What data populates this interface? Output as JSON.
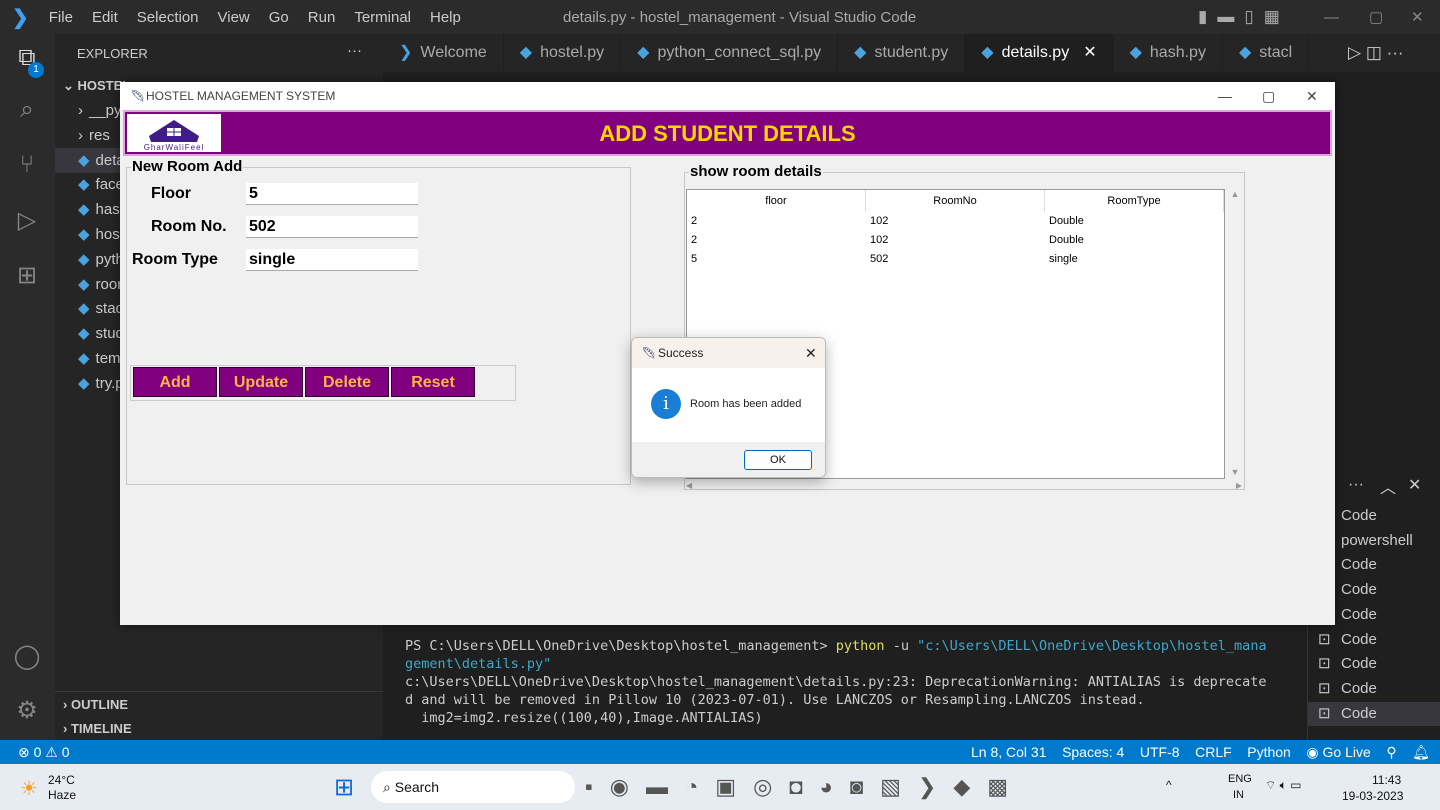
{
  "vscode": {
    "menu": [
      "File",
      "Edit",
      "Selection",
      "View",
      "Go",
      "Run",
      "Terminal",
      "Help"
    ],
    "window_title": "details.py - hostel_management - Visual Studio Code",
    "explorer_title": "EXPLORER",
    "explorer_badge": "1",
    "folder": "HOSTEL",
    "files": [
      "__py",
      "res",
      "deta",
      "face",
      "hash",
      "host",
      "pyth",
      "roor",
      "stacl",
      "stud",
      "temp",
      "try.p"
    ],
    "outline": "OUTLINE",
    "timeline": "TIMELINE",
    "tabs": [
      "Welcome",
      "hostel.py",
      "python_connect_sql.py",
      "student.py",
      "details.py",
      "hash.py",
      "stacl"
    ],
    "active_tab": "details.py",
    "terminal_lines": [
      "PS C:\\Users\\DELL\\OneDrive\\Desktop\\hostel_management> ",
      "python",
      " -u ",
      "\"c:\\Users\\DELL\\OneDrive\\Desktop\\hostel_mana",
      "gement\\details.py\"",
      "c:\\Users\\DELL\\OneDrive\\Desktop\\hostel_management\\details.py:23: DeprecationWarning: ANTIALIAS is deprecate",
      "d and will be removed in Pillow 10 (2023-07-01). Use LANCZOS or Resampling.LANCZOS instead.",
      "  img2=img2.resize((100,40),Image.ANTIALIAS)"
    ],
    "terminal_list": [
      "Code",
      "powershell",
      "Code",
      "Code",
      "Code",
      "Code",
      "Code",
      "Code",
      "Code"
    ],
    "status": {
      "errors": "0",
      "warnings": "0",
      "position": "Ln 8, Col 31",
      "spaces": "Spaces: 4",
      "encoding": "UTF-8",
      "eol": "CRLF",
      "language": "Python",
      "golive": "Go Live"
    }
  },
  "taskbar": {
    "temp": "24°C",
    "weather": "Haze",
    "search": "Search",
    "lang1": "ENG",
    "lang2": "IN",
    "time": "11:43",
    "date": "19-03-2023"
  },
  "app": {
    "title": "HOSTEL MANAGEMENT SYSTEM",
    "header": "ADD STUDENT DETAILS",
    "logo_text": "GharWaliFeel",
    "form_title": "New Room Add",
    "fields": [
      {
        "label": "Floor",
        "value": "5"
      },
      {
        "label": "Room No.",
        "value": "502"
      },
      {
        "label": "Room Type",
        "value": "single"
      }
    ],
    "buttons": [
      "Add",
      "Update",
      "Delete",
      "Reset"
    ],
    "table_title": "show room details",
    "columns": [
      "floor",
      "RoomNo",
      "RoomType"
    ],
    "rows": [
      [
        "2",
        "102",
        "Double"
      ],
      [
        "2",
        "102",
        "Double"
      ],
      [
        "5",
        "502",
        "single"
      ]
    ]
  },
  "dialog": {
    "title": "Success",
    "message": "Room has been added",
    "ok": "OK",
    "icon_color": "#1a7fd4"
  },
  "colors": {
    "header_bg": "#800080",
    "header_text": "#ffd700",
    "button_text": "#ffb347",
    "statusbar": "#007acc"
  }
}
